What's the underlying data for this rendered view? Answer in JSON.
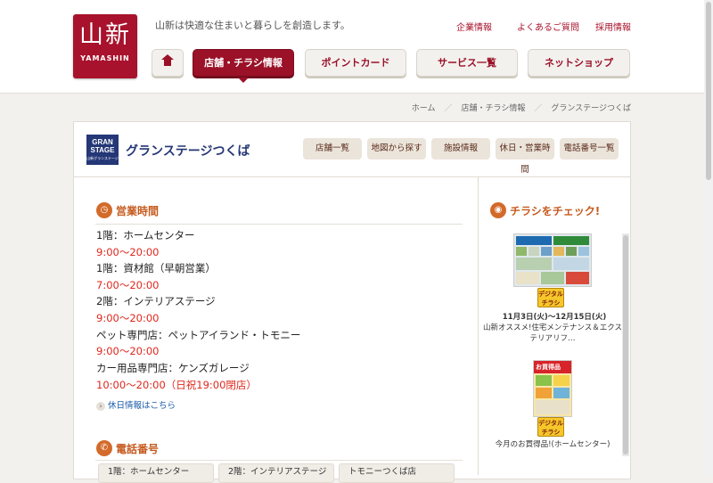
{
  "header": {
    "logo_kanji": "山新",
    "logo_roman": "YAMASHIN",
    "tagline": "山新は快適な住まいと暮らしを創造します。",
    "utility_links": [
      "企業情報",
      "よくあるご質問",
      "採用情報"
    ]
  },
  "nav": {
    "items": [
      "店舗・チラシ情報",
      "ポイントカード",
      "サービス一覧",
      "ネットショップ"
    ],
    "active": "店舗・チラシ情報"
  },
  "breadcrumb": [
    "ホーム",
    "店舗・チラシ情報",
    "グランステージつくば"
  ],
  "store": {
    "logo_text_1": "GRAN",
    "logo_text_2": "STAGE",
    "logo_sub": "山新グランステージ",
    "name": "グランステージつくば",
    "subnav": [
      "店舗一覧",
      "地図から探す",
      "施設情報",
      "休日・営業時間",
      "電話番号一覧"
    ]
  },
  "hours": {
    "heading": "営業時間",
    "rows": [
      {
        "label": "1階：ホームセンター",
        "time": "9:00〜20:00"
      },
      {
        "label": "1階：資材館（早朝営業）",
        "time": "7:00〜20:00"
      },
      {
        "label": "2階：インテリアステージ",
        "time": "9:00〜20:00"
      },
      {
        "label": "ペット専門店：ペットアイランド・トモニー",
        "time": "9:00〜20:00"
      },
      {
        "label": "カー用品専門店：ケンズガレージ",
        "time": "10:00〜20:00（日祝19:00閉店）"
      }
    ],
    "holiday_link": "休日情報はこちら"
  },
  "phone": {
    "heading": "電話番号",
    "tabs": [
      "1階：ホームセンター",
      "2階：インテリアステージ",
      "トモニーつくば店"
    ]
  },
  "flyers": {
    "heading": "チラシをチェック!",
    "badge_line1": "デジタル",
    "badge_line2": "チラシ",
    "items": [
      {
        "date": "11月3日(火)〜12月15日(火)",
        "title": "山新オススメ!住宅メンテナンス＆エクステリアリフ…"
      },
      {
        "title": "今月のお買得品!(ホームセンター)",
        "banner": "お買得品"
      }
    ]
  },
  "colors": {
    "brand": "#a8122c",
    "accent_orange": "#d36a2a",
    "time_red": "#e0281e",
    "store_blue": "#243776"
  }
}
